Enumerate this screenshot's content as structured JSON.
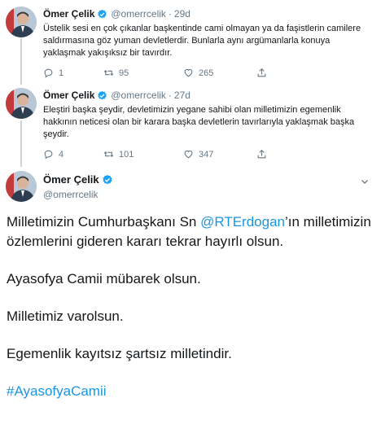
{
  "tweets": [
    {
      "name": "Ömer Çelik",
      "handle": "@omerrcelik",
      "dot": "·",
      "time": "29d",
      "text": "Üstelik sesi en çok çıkanlar başkentinde cami olmayan ya da faşistlerin camilere saldırmasına göz yuman devletlerdir. Bunlarla aynı argümanlarla konuya yaklaşmak yakışıksız bir tavırdır.",
      "replies": "1",
      "retweets": "95",
      "likes": "265"
    },
    {
      "name": "Ömer Çelik",
      "handle": "@omerrcelik",
      "dot": "·",
      "time": "27d",
      "text": "Eleştiri başka şeydir, devletimizin yegane sahibi olan milletimizin egemenlik hakkının neticesi olan bir karara başka devletlerin tavırlarıyla yaklaşmak başka şeydir.",
      "replies": "4",
      "retweets": "101",
      "likes": "347"
    }
  ],
  "main": {
    "name": "Ömer Çelik",
    "handle": "@omerrcelik",
    "p1_before": "Milletimizin Cumhurbaşkanı Sn ",
    "p1_mention": "@RTErdogan",
    "p1_after": "’ın milletimizin özlemlerini gideren kararı tekrar hayırlı olsun.",
    "p2": "Ayasofya Camii mübarek olsun.",
    "p3": "Milletimiz varolsun.",
    "p4": "Egemenlik kayıtsız şartsız milletindir.",
    "hashtag": "#AyasofyaCamii"
  },
  "colors": {
    "link": "#1b95e0",
    "muted": "#657786",
    "verified": "#1da1f2",
    "thread_line": "#ccd6dd"
  }
}
